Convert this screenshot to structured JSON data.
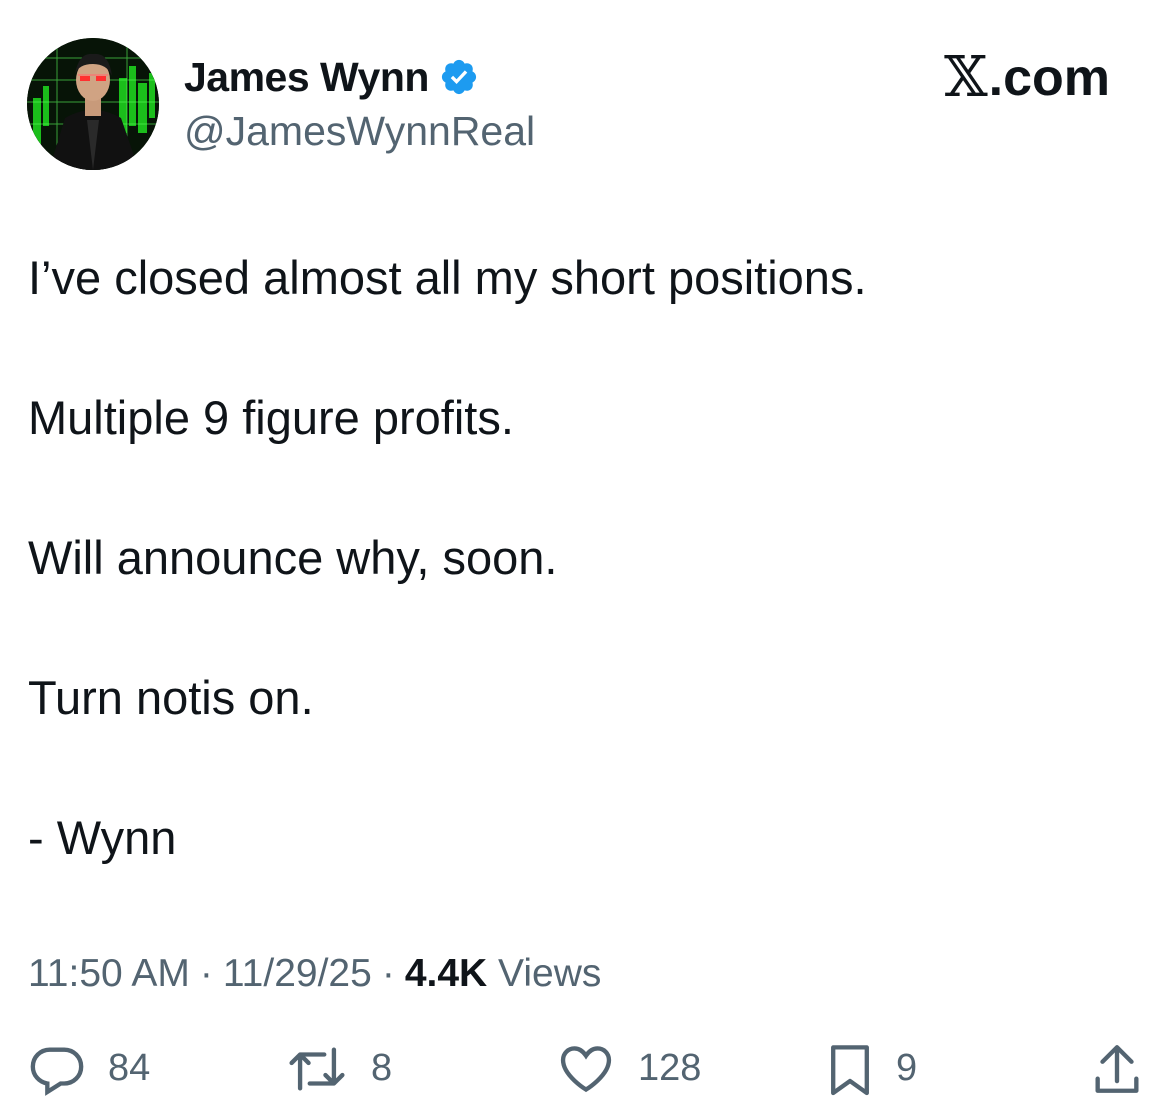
{
  "post": {
    "author": {
      "display_name": "James Wynn",
      "handle": "@JamesWynnReal",
      "verified_icon": "verified-badge-icon",
      "avatar": "avatar-image"
    },
    "brand": {
      "x_mark": "𝕏",
      "suffix": ".com"
    },
    "body_lines": [
      "I’ve closed almost all my short positions.",
      "Multiple 9 figure profits.",
      "Will announce why, soon.",
      "Turn notis on.",
      "- Wynn"
    ],
    "meta": {
      "time": "11:50 AM",
      "separator": "·",
      "date": "11/29/25",
      "views_count": "4.4K",
      "views_label": "Views"
    },
    "actions": {
      "reply": {
        "icon": "reply-icon",
        "count": "84"
      },
      "repost": {
        "icon": "repost-icon",
        "count": "8"
      },
      "like": {
        "icon": "heart-icon",
        "count": "128"
      },
      "bookmark": {
        "icon": "bookmark-icon",
        "count": "9"
      },
      "share": {
        "icon": "share-icon"
      }
    }
  },
  "colors": {
    "text_primary": "#0f1419",
    "text_secondary": "#536471",
    "verified_blue": "#1d9bf0",
    "avatar_green": "#19d919"
  }
}
